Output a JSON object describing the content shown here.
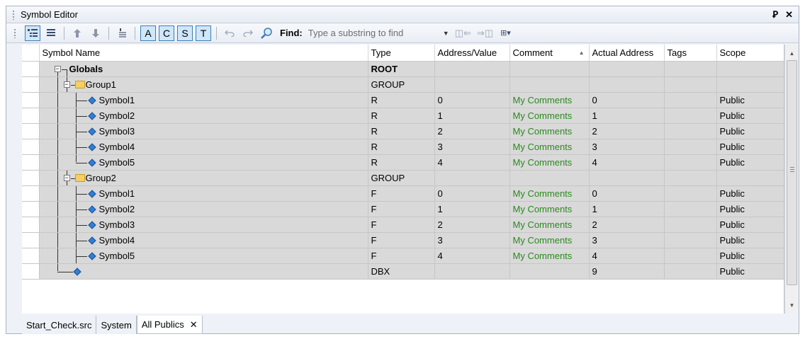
{
  "window": {
    "title": "Symbol Editor",
    "pin_glyph": "Ꝑ",
    "close_glyph": "✕"
  },
  "toolbar": {
    "letters": [
      "A",
      "C",
      "S",
      "T"
    ],
    "find_label": "Find:",
    "find_placeholder": "Type a substring to find"
  },
  "columns": [
    "Symbol Name",
    "Type",
    "Address/Value",
    "Comment",
    "Actual Address",
    "Tags",
    "Scope"
  ],
  "rows": [
    {
      "name": "Globals",
      "type": "ROOT",
      "addr": "",
      "comment": "",
      "actual": "",
      "tags": "",
      "scope": ""
    },
    {
      "name": "Group1",
      "type": "GROUP",
      "addr": "",
      "comment": "",
      "actual": "",
      "tags": "",
      "scope": ""
    },
    {
      "name": "Symbol1",
      "type": "R",
      "addr": "0",
      "comment": "My Comments",
      "actual": "0",
      "tags": "",
      "scope": "Public"
    },
    {
      "name": "Symbol2",
      "type": "R",
      "addr": "1",
      "comment": "My Comments",
      "actual": "1",
      "tags": "",
      "scope": "Public"
    },
    {
      "name": "Symbol3",
      "type": "R",
      "addr": "2",
      "comment": "My Comments",
      "actual": "2",
      "tags": "",
      "scope": "Public"
    },
    {
      "name": "Symbol4",
      "type": "R",
      "addr": "3",
      "comment": "My Comments",
      "actual": "3",
      "tags": "",
      "scope": "Public"
    },
    {
      "name": "Symbol5",
      "type": "R",
      "addr": "4",
      "comment": "My Comments",
      "actual": "4",
      "tags": "",
      "scope": "Public"
    },
    {
      "name": "Group2",
      "type": "GROUP",
      "addr": "",
      "comment": "",
      "actual": "",
      "tags": "",
      "scope": ""
    },
    {
      "name": "Symbol1",
      "type": "F",
      "addr": "0",
      "comment": "My Comments",
      "actual": "0",
      "tags": "",
      "scope": "Public"
    },
    {
      "name": "Symbol2",
      "type": "F",
      "addr": "1",
      "comment": "My Comments",
      "actual": "1",
      "tags": "",
      "scope": "Public"
    },
    {
      "name": "Symbol3",
      "type": "F",
      "addr": "2",
      "comment": "My Comments",
      "actual": "2",
      "tags": "",
      "scope": "Public"
    },
    {
      "name": "Symbol4",
      "type": "F",
      "addr": "3",
      "comment": "My Comments",
      "actual": "3",
      "tags": "",
      "scope": "Public"
    },
    {
      "name": "Symbol5",
      "type": "F",
      "addr": "4",
      "comment": "My Comments",
      "actual": "4",
      "tags": "",
      "scope": "Public"
    },
    {
      "name": "",
      "type": "DBX",
      "addr": "",
      "comment": "",
      "actual": "9",
      "tags": "",
      "scope": "Public"
    }
  ],
  "tabs": [
    {
      "label": "Start_Check.src",
      "active": false
    },
    {
      "label": "System",
      "active": false
    },
    {
      "label": "All Publics",
      "active": true
    }
  ],
  "tab_close_glyph": "✕",
  "colors": {
    "comment": "#2a8a1e",
    "row_bg": "#d9d9d9",
    "toolbar_check": "#cfe6fb"
  }
}
